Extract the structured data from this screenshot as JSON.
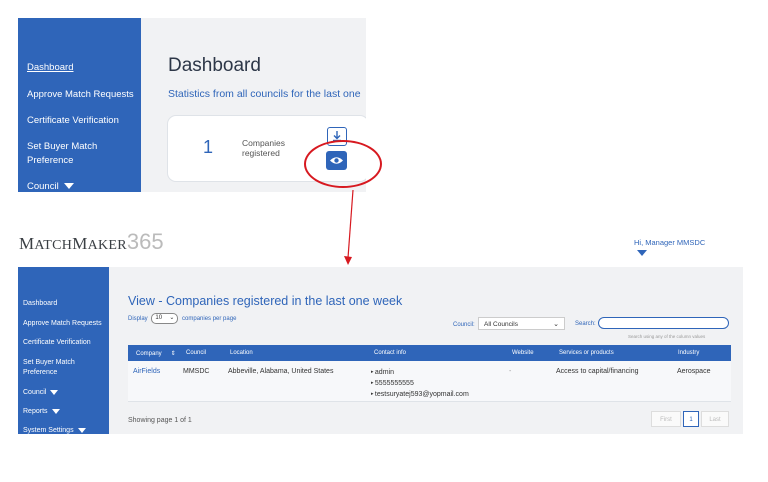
{
  "top_screenshot": {
    "sidebar": {
      "items": [
        {
          "label": "Dashboard"
        },
        {
          "label": "Approve Match Requests"
        },
        {
          "label": "Certificate Verification"
        },
        {
          "label": "Set Buyer Match"
        },
        {
          "label": "Preference"
        },
        {
          "label": "Council"
        }
      ]
    },
    "title": "Dashboard",
    "subtitle": "Statistics from all councils for the last one",
    "card": {
      "count": "1",
      "label_line1": "Companies",
      "label_line2": "registered",
      "download_icon": "download-icon",
      "view_icon": "eye-icon"
    }
  },
  "annotation": {
    "highlight_color": "#d71920"
  },
  "header": {
    "logo_part1": "M",
    "logo_part2": "ATCH",
    "logo_part3": "M",
    "logo_part4": "AKER",
    "logo_part5": "365",
    "greeting": "Hi, Manager MMSDC"
  },
  "bottom_screenshot": {
    "sidebar": {
      "items": [
        {
          "label": "Dashboard"
        },
        {
          "label": "Approve Match Requests"
        },
        {
          "label": "Certificate Verification"
        },
        {
          "label": "Set Buyer Match"
        },
        {
          "label": "Preference"
        },
        {
          "label": "Council"
        },
        {
          "label": "Reports"
        },
        {
          "label": "System Settings"
        }
      ]
    },
    "view_title": "View - Companies registered in the last one week",
    "display": {
      "prefix": "Display",
      "value": "10",
      "suffix": "companies per page"
    },
    "council": {
      "label": "Council:",
      "value": "All Councils"
    },
    "search": {
      "label": "Search:",
      "placeholder": "",
      "hint": "Search using any of the column values"
    },
    "table": {
      "columns": [
        "Company",
        "Council",
        "Location",
        "Contact info",
        "Website",
        "Services or products",
        "Industry"
      ],
      "rows": [
        {
          "company": "AirFields",
          "council": "MMSDC",
          "location": "Abbeville, Alabama, United States",
          "contact": [
            "admin",
            "5555555555",
            "testsuryatej593@yopmail.com"
          ],
          "website": "-",
          "services": "Access to capital/financing",
          "industry": "Aerospace"
        }
      ]
    },
    "footer": {
      "showing": "Showing page 1 of 1"
    },
    "pager": {
      "first": "First",
      "current": "1",
      "last": "Last"
    }
  },
  "colors": {
    "primary": "#2f65b9",
    "accent_red": "#d71920"
  }
}
